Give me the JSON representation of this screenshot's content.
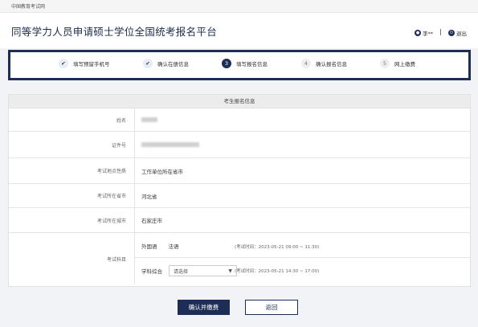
{
  "topbar": {
    "site": "中国教育考试网"
  },
  "header": {
    "title": "同等学力人员申请硕士学位全国统考报名平台",
    "user": "李**",
    "separator": "|",
    "logout": "退出"
  },
  "steps": [
    {
      "num": "✔",
      "label": "填写预留手机号",
      "state": "done"
    },
    {
      "num": "✔",
      "label": "确认在册信息",
      "state": "done"
    },
    {
      "num": "3",
      "label": "填写报名信息",
      "state": "active"
    },
    {
      "num": "4",
      "label": "确认报名信息",
      "state": "todo"
    },
    {
      "num": "5",
      "label": "网上缴费",
      "state": "todo"
    }
  ],
  "form": {
    "heading": "考生报名信息",
    "name_label": "姓名",
    "id_label": "证件号",
    "exam_type_label": "考试地点性质",
    "exam_type_value": "工作单位所在省市",
    "province_label": "考试所在省市",
    "province_value": "河北省",
    "city_label": "考试所在城市",
    "city_value": "石家庄市",
    "subject_label": "考试科目",
    "subject1_label": "外国语",
    "subject1_value": "法语",
    "subject1_time": "(考试时间：2023-05-21 09:00 ~ 11:30)",
    "subject2_label": "学科综合",
    "subject2_placeholder": "请选择",
    "subject2_time": "(考试时间：2023-05-21 14:30 ~ 17:00)"
  },
  "buttons": {
    "confirm": "确认并缴费",
    "back": "返回"
  },
  "colors": {
    "primary": "#1d2d55",
    "background": "#f2f3f6"
  }
}
